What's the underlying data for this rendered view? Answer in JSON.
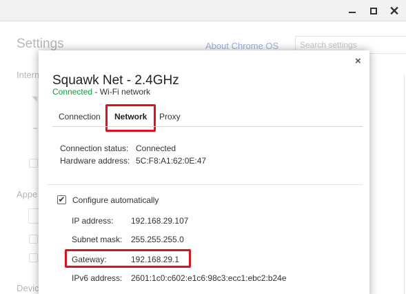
{
  "window": {
    "controls": {
      "minimize_icon": "minimize-icon",
      "maximize_icon": "maximize-icon",
      "close_label": "✕"
    }
  },
  "settings": {
    "title": "Settings",
    "about_link": "About Chrome OS",
    "search_placeholder": "Search settings",
    "sections": {
      "internet": "Intern",
      "appearance": "Appe",
      "device": "Devic"
    }
  },
  "dialog": {
    "close_label": "×",
    "network_name": "Squawk Net - 2.4GHz",
    "state": "Connected",
    "state_suffix": " - Wi-Fi network",
    "tabs": [
      {
        "label": "Connection"
      },
      {
        "label": "Network"
      },
      {
        "label": "Proxy"
      }
    ],
    "active_tab": "Network",
    "connection_status_label": "Connection status:",
    "connection_status_value": "Connected",
    "hardware_address_label": "Hardware address:",
    "hardware_address_value": "5C:F8:A1:62:0E:47",
    "configure_automatically": {
      "label": "Configure automatically",
      "checked": true,
      "mark": "✔"
    },
    "fields": [
      {
        "label": "IP address:",
        "value": "192.168.29.107"
      },
      {
        "label": "Subnet mask:",
        "value": "255.255.255.0"
      },
      {
        "label": "Gateway:",
        "value": "192.168.29.1"
      },
      {
        "label": "IPv6 address:",
        "value": "2601:1c0:c602:e1c6:98c3:ecc1:ebc2:b24e"
      }
    ]
  },
  "colors": {
    "highlight": "#e0111d",
    "connected_green": "#0a9e3a"
  }
}
